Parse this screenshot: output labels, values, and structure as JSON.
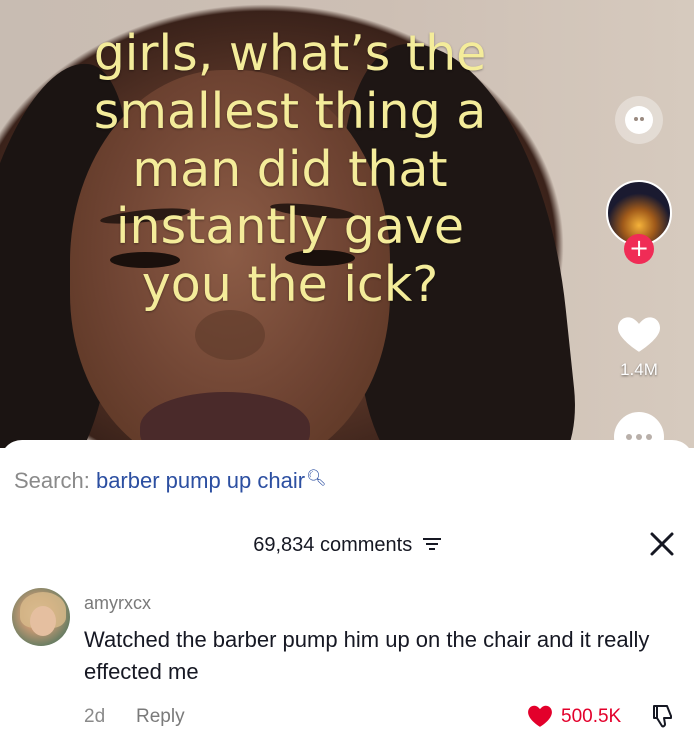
{
  "video": {
    "caption": "girls, what’s the\nsmallest thing a\nman did that\ninstantly gave\nyou the ick?",
    "like_count": "1.4M"
  },
  "colors": {
    "caption_yellow": "#f4ec9a",
    "search_blue": "#2c4fa1",
    "like_red": "#e3002b",
    "follow_pink": "#f02c56"
  },
  "sheet": {
    "search_label": "Search:",
    "search_query": "barber pump up chair",
    "comments_count": "69,834 comments",
    "comment": {
      "username": "amyrxcx",
      "text": "Watched the barber pump him up on the chair and it really effected me",
      "age": "2d",
      "reply_label": "Reply",
      "likes": "500.5K"
    }
  },
  "icons": [
    "chat-icon",
    "follow-plus-icon",
    "heart-icon",
    "more-icon",
    "search-icon",
    "filter-icon",
    "close-icon",
    "liked-heart-icon",
    "dislike-icon"
  ]
}
